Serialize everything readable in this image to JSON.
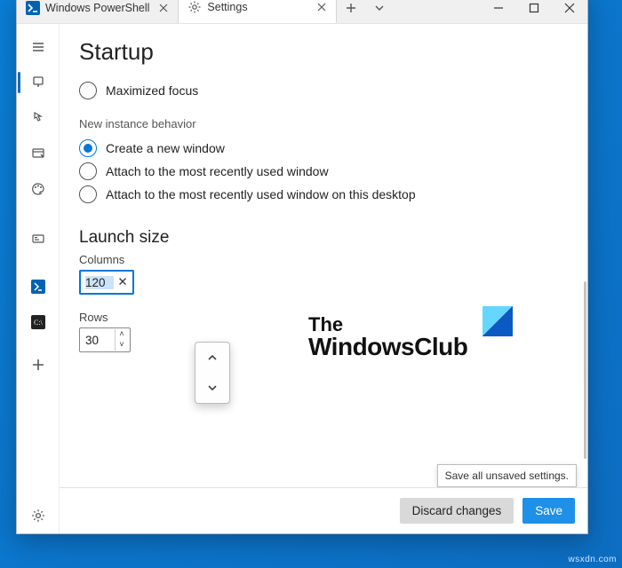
{
  "tabs": [
    {
      "label": "Windows PowerShell",
      "icon": "powershell-icon"
    },
    {
      "label": "Settings",
      "icon": "gear-icon"
    }
  ],
  "active_tab_index": 1,
  "sidebar": {
    "items": [
      {
        "name": "menu-icon",
        "interact": true
      },
      {
        "name": "launch-icon",
        "interact": true,
        "active": true
      },
      {
        "name": "interaction-icon",
        "interact": true
      },
      {
        "name": "appearance-icon",
        "interact": true
      },
      {
        "name": "color-schemes-icon",
        "interact": true
      },
      {
        "name": "rendering-icon",
        "interact": true
      }
    ],
    "profiles": [
      {
        "name": "powershell-profile-icon"
      },
      {
        "name": "cmd-profile-icon"
      },
      {
        "name": "add-profile-icon"
      }
    ],
    "footer": {
      "name": "settings-gear-icon"
    }
  },
  "page": {
    "title": "Startup",
    "radio_maximized": "Maximized focus",
    "section_nib": "New instance behavior",
    "nib_options": [
      "Create a new window",
      "Attach to the most recently used window",
      "Attach to the most recently used window on this desktop"
    ],
    "nib_selected_index": 0,
    "launch_size_heading": "Launch size",
    "columns_label": "Columns",
    "columns_value": "120",
    "rows_label": "Rows",
    "rows_value": "30"
  },
  "brand": {
    "line1": "The",
    "line2": "WindowsClub"
  },
  "buttons": {
    "discard": "Discard changes",
    "save": "Save"
  },
  "tooltip_save": "Save all unsaved settings.",
  "watermark": "wsxdn.com"
}
